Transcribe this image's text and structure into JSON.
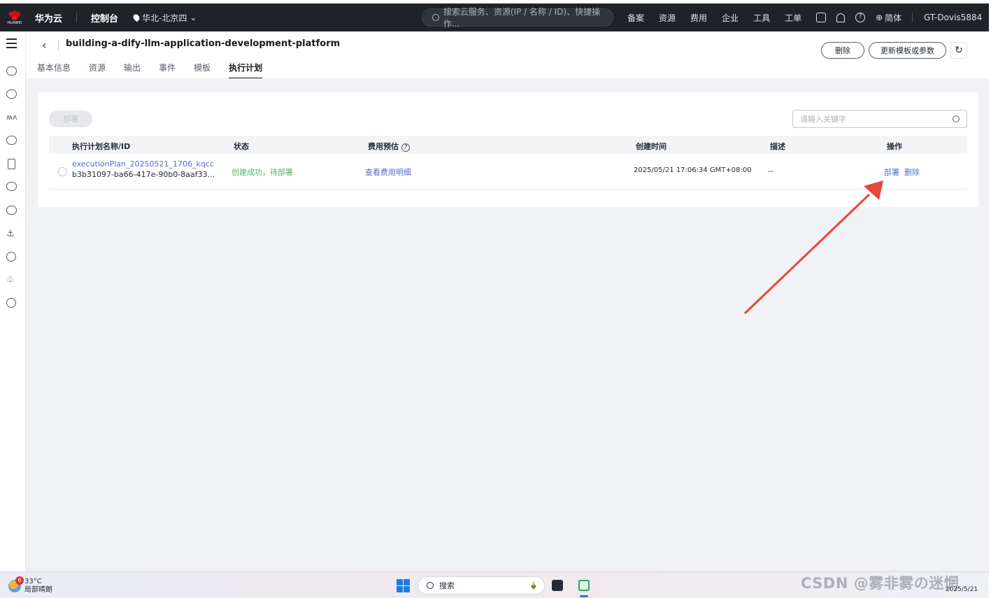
{
  "topbar": {
    "brand_word": "HUAWEI",
    "brand": "华为云",
    "console": "控制台",
    "region": "华北-北京四",
    "search_placeholder": "搜索云服务、资源(IP / 名称 / ID)、快捷操作...",
    "nav": [
      "备案",
      "资源",
      "费用",
      "企业",
      "工具",
      "工单"
    ],
    "lang": "简体",
    "user": "GT-Dovis5884"
  },
  "header": {
    "title": "building-a-dify-llm-application-development-platform",
    "tabs": [
      "基本信息",
      "资源",
      "输出",
      "事件",
      "模板",
      "执行计划"
    ],
    "active_tab": "执行计划",
    "delete_label": "删除",
    "update_label": "更新模板或参数"
  },
  "toolbar": {
    "deploy_label": "部署",
    "keyword_placeholder": "请输入关键字"
  },
  "table": {
    "columns": [
      "执行计划名称/ID",
      "状态",
      "费用预估",
      "创建时间",
      "描述",
      "操作"
    ],
    "rows": [
      {
        "name": "executionPlan_20250521_1706_kqcc",
        "id": "b3b31097-ba66-417e-90b0-8aaf33...",
        "status": "创建成功，待部署",
        "cost": "查看费用明细",
        "created": "2025/05/21 17:06:34 GMT+08:00",
        "desc": "--",
        "actions": [
          "部署",
          "删除"
        ]
      }
    ]
  },
  "annotation": {
    "arrow_color": "#e8473b"
  },
  "taskbar": {
    "temp": "33°C",
    "weather": "局部晴朗",
    "badge": "6",
    "search_label": "搜索",
    "watermark": "CSDN @雾非雾の迷惘",
    "date": "2025/5/21"
  }
}
